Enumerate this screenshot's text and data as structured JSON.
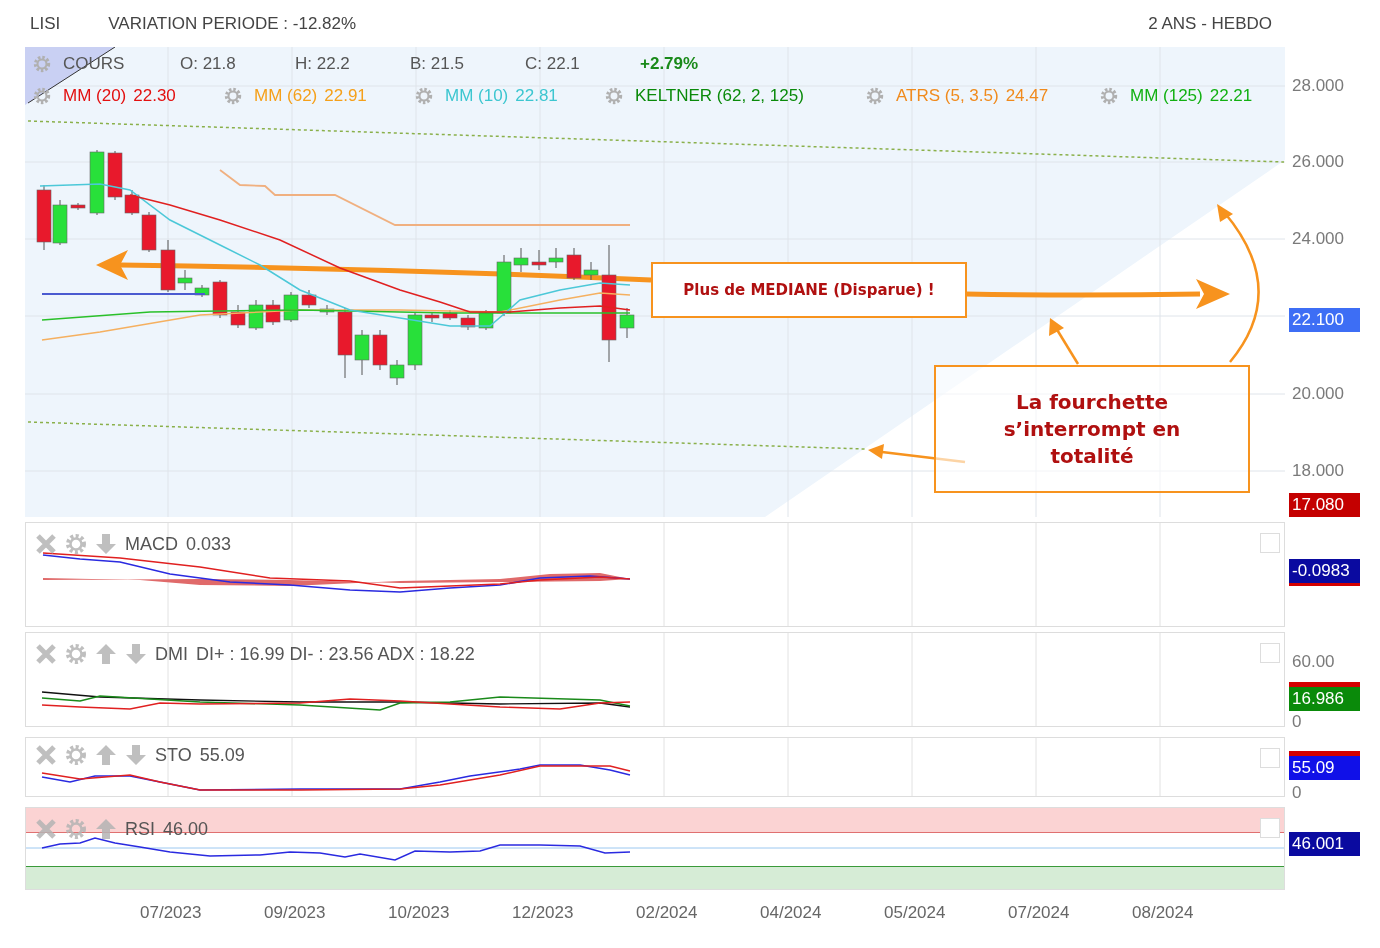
{
  "header": {
    "symbol": "LISI",
    "variation": "VARIATION PERIODE : -12.82%",
    "period": "2 ANS - HEBDO"
  },
  "price_panel": {
    "quote": [
      {
        "kind": "title",
        "text": "COURS"
      },
      {
        "kind": "value",
        "text": "O: 21.8"
      },
      {
        "kind": "value",
        "text": "H: 22.2"
      },
      {
        "kind": "value",
        "text": "B: 21.5"
      },
      {
        "kind": "value",
        "text": "C: 22.1"
      },
      {
        "kind": "change",
        "text": "+2.79%"
      }
    ],
    "indicators": [
      {
        "label": "MM (20)",
        "value": "22.30",
        "color": "#e31010"
      },
      {
        "label": "MM (62)",
        "value": "22.91",
        "color": "#f5a01a"
      },
      {
        "label": "MM (10)",
        "value": "22.81",
        "color": "#3cc6d0"
      },
      {
        "label": "KELTNER (62, 2, 125)",
        "color": "#0a8a0a"
      },
      {
        "label": "ATRS (5, 3.5)",
        "value": "24.47",
        "color": "#f08a1c"
      },
      {
        "label": "MM (125)",
        "value": "22.21",
        "color": "#12b012"
      }
    ],
    "y_axis": [
      {
        "kind": "tick",
        "text": "28.000"
      },
      {
        "kind": "tick",
        "text": "26.000"
      },
      {
        "kind": "tick",
        "text": "24.000"
      },
      {
        "kind": "badge",
        "text": "22.100",
        "color": "#3d6ef5"
      },
      {
        "kind": "tick",
        "text": "20.000"
      },
      {
        "kind": "tick",
        "text": "18.000"
      },
      {
        "kind": "badge",
        "text": "17.080",
        "color": "#c40000"
      }
    ],
    "annotations": [
      {
        "text": "Plus de MEDIANE (Disparue) !"
      },
      {
        "text": "La fourchette s’interrompt en totalité"
      }
    ]
  },
  "sub_panels": [
    {
      "kind": "macd",
      "name": "MACD",
      "value": "0.033",
      "can_move_up": false,
      "can_move_down": true,
      "checked": false,
      "axis": [
        {
          "kind": "badge",
          "text": "-0.0983",
          "color": "#0a0aa0",
          "marker_above": false,
          "marker_below": true
        }
      ]
    },
    {
      "kind": "dmi",
      "name": "DMI",
      "value": "DI+ : 16.99 DI- : 23.56 ADX : 18.22",
      "can_move_up": true,
      "can_move_down": true,
      "checked": false,
      "axis": [
        {
          "kind": "tick",
          "text": "60.00"
        },
        {
          "kind": "badge",
          "text": "16.986",
          "color": "#0a8a0a",
          "marker_above": true,
          "marker_below": false
        },
        {
          "kind": "tick",
          "text": "0"
        }
      ]
    },
    {
      "kind": "sto",
      "name": "STO",
      "value": "55.09",
      "can_move_up": true,
      "can_move_down": true,
      "checked": false,
      "axis": [
        {
          "kind": "badge",
          "text": "55.09",
          "color": "#1010e8",
          "marker_above": true,
          "marker_below": false
        },
        {
          "kind": "tick",
          "text": "0"
        }
      ]
    },
    {
      "kind": "rsi",
      "name": "RSI",
      "value": "46.00",
      "can_move_up": true,
      "can_move_down": false,
      "checked": false,
      "axis": [
        {
          "kind": "badge",
          "text": "46.001",
          "color": "#0a0aa0",
          "marker_above": false,
          "marker_below": false
        }
      ]
    }
  ],
  "x_axis": [
    "07/2023",
    "09/2023",
    "10/2023",
    "12/2023",
    "02/2024",
    "04/2024",
    "05/2024",
    "07/2024",
    "08/2024"
  ]
}
